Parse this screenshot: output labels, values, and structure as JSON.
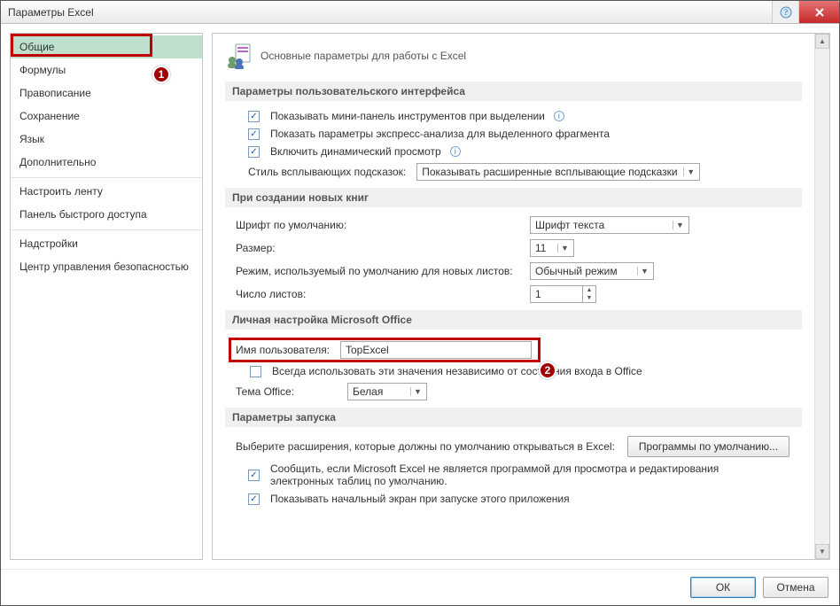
{
  "window": {
    "title": "Параметры Excel"
  },
  "sidebar": {
    "items": [
      "Общие",
      "Формулы",
      "Правописание",
      "Сохранение",
      "Язык",
      "Дополнительно",
      "Настроить ленту",
      "Панель быстрого доступа",
      "Надстройки",
      "Центр управления безопасностью"
    ]
  },
  "annotations": {
    "badge1": "1",
    "badge2": "2"
  },
  "heading": "Основные параметры для работы с Excel",
  "sec1": {
    "title": "Параметры пользовательского интерфейса",
    "c1": "Показывать мини-панель инструментов при выделении",
    "c2": "Показать параметры экспресс-анализа для выделенного фрагмента",
    "c3": "Включить динамический просмотр",
    "tooltip_label": "Стиль всплывающих подсказок:",
    "tooltip_value": "Показывать расширенные всплывающие подсказки"
  },
  "sec2": {
    "title": "При создании новых книг",
    "font_label": "Шрифт по умолчанию:",
    "font_value": "Шрифт текста",
    "size_label": "Размер:",
    "size_value": "11",
    "view_label": "Режим, используемый по умолчанию для новых листов:",
    "view_value": "Обычный режим",
    "sheets_label": "Число листов:",
    "sheets_value": "1"
  },
  "sec3": {
    "title": "Личная настройка Microsoft Office",
    "user_label": "Имя пользователя:",
    "user_value": "TopExcel",
    "always": "Всегда использовать эти значения независимо от состояния входа в Office",
    "theme_label": "Тема Office:",
    "theme_value": "Белая"
  },
  "sec4": {
    "title": "Параметры запуска",
    "ext_label": "Выберите расширения, которые должны по умолчанию открываться в Excel:",
    "ext_btn": "Программы по умолчанию...",
    "c1": "Сообщить, если Microsoft Excel не является программой для просмотра и редактирования электронных таблиц по умолчанию.",
    "c2": "Показывать начальный экран при запуске этого приложения"
  },
  "footer": {
    "ok": "ОК",
    "cancel": "Отмена"
  }
}
